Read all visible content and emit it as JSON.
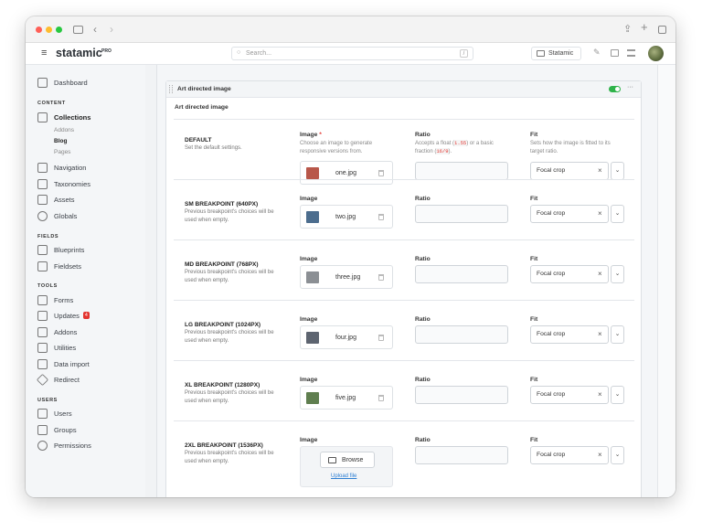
{
  "app": {
    "name": "statamic",
    "edition": "PRO"
  },
  "search": {
    "placeholder": "Search...",
    "shortcut": "/"
  },
  "header": {
    "site_label": "Statamic"
  },
  "sidebar": {
    "dashboard": "Dashboard",
    "content_heading": "CONTENT",
    "collections": "Collections",
    "collection_children": [
      "Addons",
      "Blog",
      "Pages"
    ],
    "navigation": "Navigation",
    "taxonomies": "Taxonomies",
    "assets": "Assets",
    "globals": "Globals",
    "fields_heading": "FIELDS",
    "blueprints": "Blueprints",
    "fieldsets": "Fieldsets",
    "tools_heading": "TOOLS",
    "forms": "Forms",
    "updates": "Updates",
    "updates_badge": "4",
    "addons": "Addons",
    "utilities": "Utilities",
    "data_import": "Data import",
    "redirect": "Redirect",
    "users_heading": "USERS",
    "users": "Users",
    "groups": "Groups",
    "permissions": "Permissions"
  },
  "panel": {
    "title": "Art directed image",
    "field_title": "Art directed image",
    "more": "···"
  },
  "columns": {
    "image_label": "Image",
    "ratio_label": "Ratio",
    "fit_label": "Fit",
    "image_desc": "Choose an image to generate responsive versions from.",
    "ratio_desc_before": "Accepts a float (",
    "ratio_example1": "1.55",
    "ratio_desc_mid": ") or a basic fraction (",
    "ratio_example2": "16/9",
    "ratio_desc_after": ").",
    "fit_desc": "Sets how the image is fitted to its target ratio."
  },
  "breakpoints": [
    {
      "title": "DEFAULT",
      "desc": "Set the default settings.",
      "file": "one.jpg",
      "fit": "Focal crop",
      "thumb": "#b8574a"
    },
    {
      "title": "SM BREAKPOINT (640PX)",
      "desc": "Previous breakpoint's choices will be used when empty.",
      "file": "two.jpg",
      "fit": "Focal crop",
      "thumb": "#4c6d8e"
    },
    {
      "title": "MD BREAKPOINT (768PX)",
      "desc": "Previous breakpoint's choices will be used when empty.",
      "file": "three.jpg",
      "fit": "Focal crop",
      "thumb": "#8b8f94"
    },
    {
      "title": "LG BREAKPOINT (1024PX)",
      "desc": "Previous breakpoint's choices will be used when empty.",
      "file": "four.jpg",
      "fit": "Focal crop",
      "thumb": "#5d6470"
    },
    {
      "title": "XL BREAKPOINT (1280PX)",
      "desc": "Previous breakpoint's choices will be used when empty.",
      "file": "five.jpg",
      "fit": "Focal crop",
      "thumb": "#5f7e4f"
    },
    {
      "title": "2XL BREAKPOINT (1536PX)",
      "desc": "Previous breakpoint's choices will be used when empty.",
      "file": "",
      "fit": "Focal crop",
      "thumb": ""
    }
  ],
  "browse": {
    "label": "Browse",
    "upload": "Upload file"
  },
  "colors": {
    "accent": "#2fb34a",
    "brand": "#2b3036",
    "link": "#2e7fd3",
    "required": "#e3342f"
  }
}
